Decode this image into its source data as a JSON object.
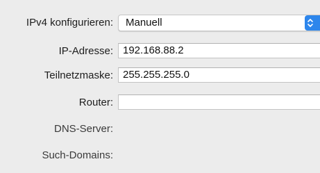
{
  "form": {
    "ipv4_config": {
      "label": "IPv4 konfigurieren:",
      "value": "Manuell"
    },
    "ip_address": {
      "label": "IP-Adresse:",
      "value": "192.168.88.2"
    },
    "subnet_mask": {
      "label": "Teilnetzmaske:",
      "value": "255.255.255.0"
    },
    "router": {
      "label": "Router:",
      "value": ""
    },
    "dns_server": {
      "label": "DNS-Server:"
    },
    "search_domains": {
      "label": "Such-Domains:"
    }
  },
  "colors": {
    "accent": "#2d86ec",
    "background": "#ececec"
  },
  "icons": {
    "popup_stepper": "chevron-up-down-icon"
  }
}
